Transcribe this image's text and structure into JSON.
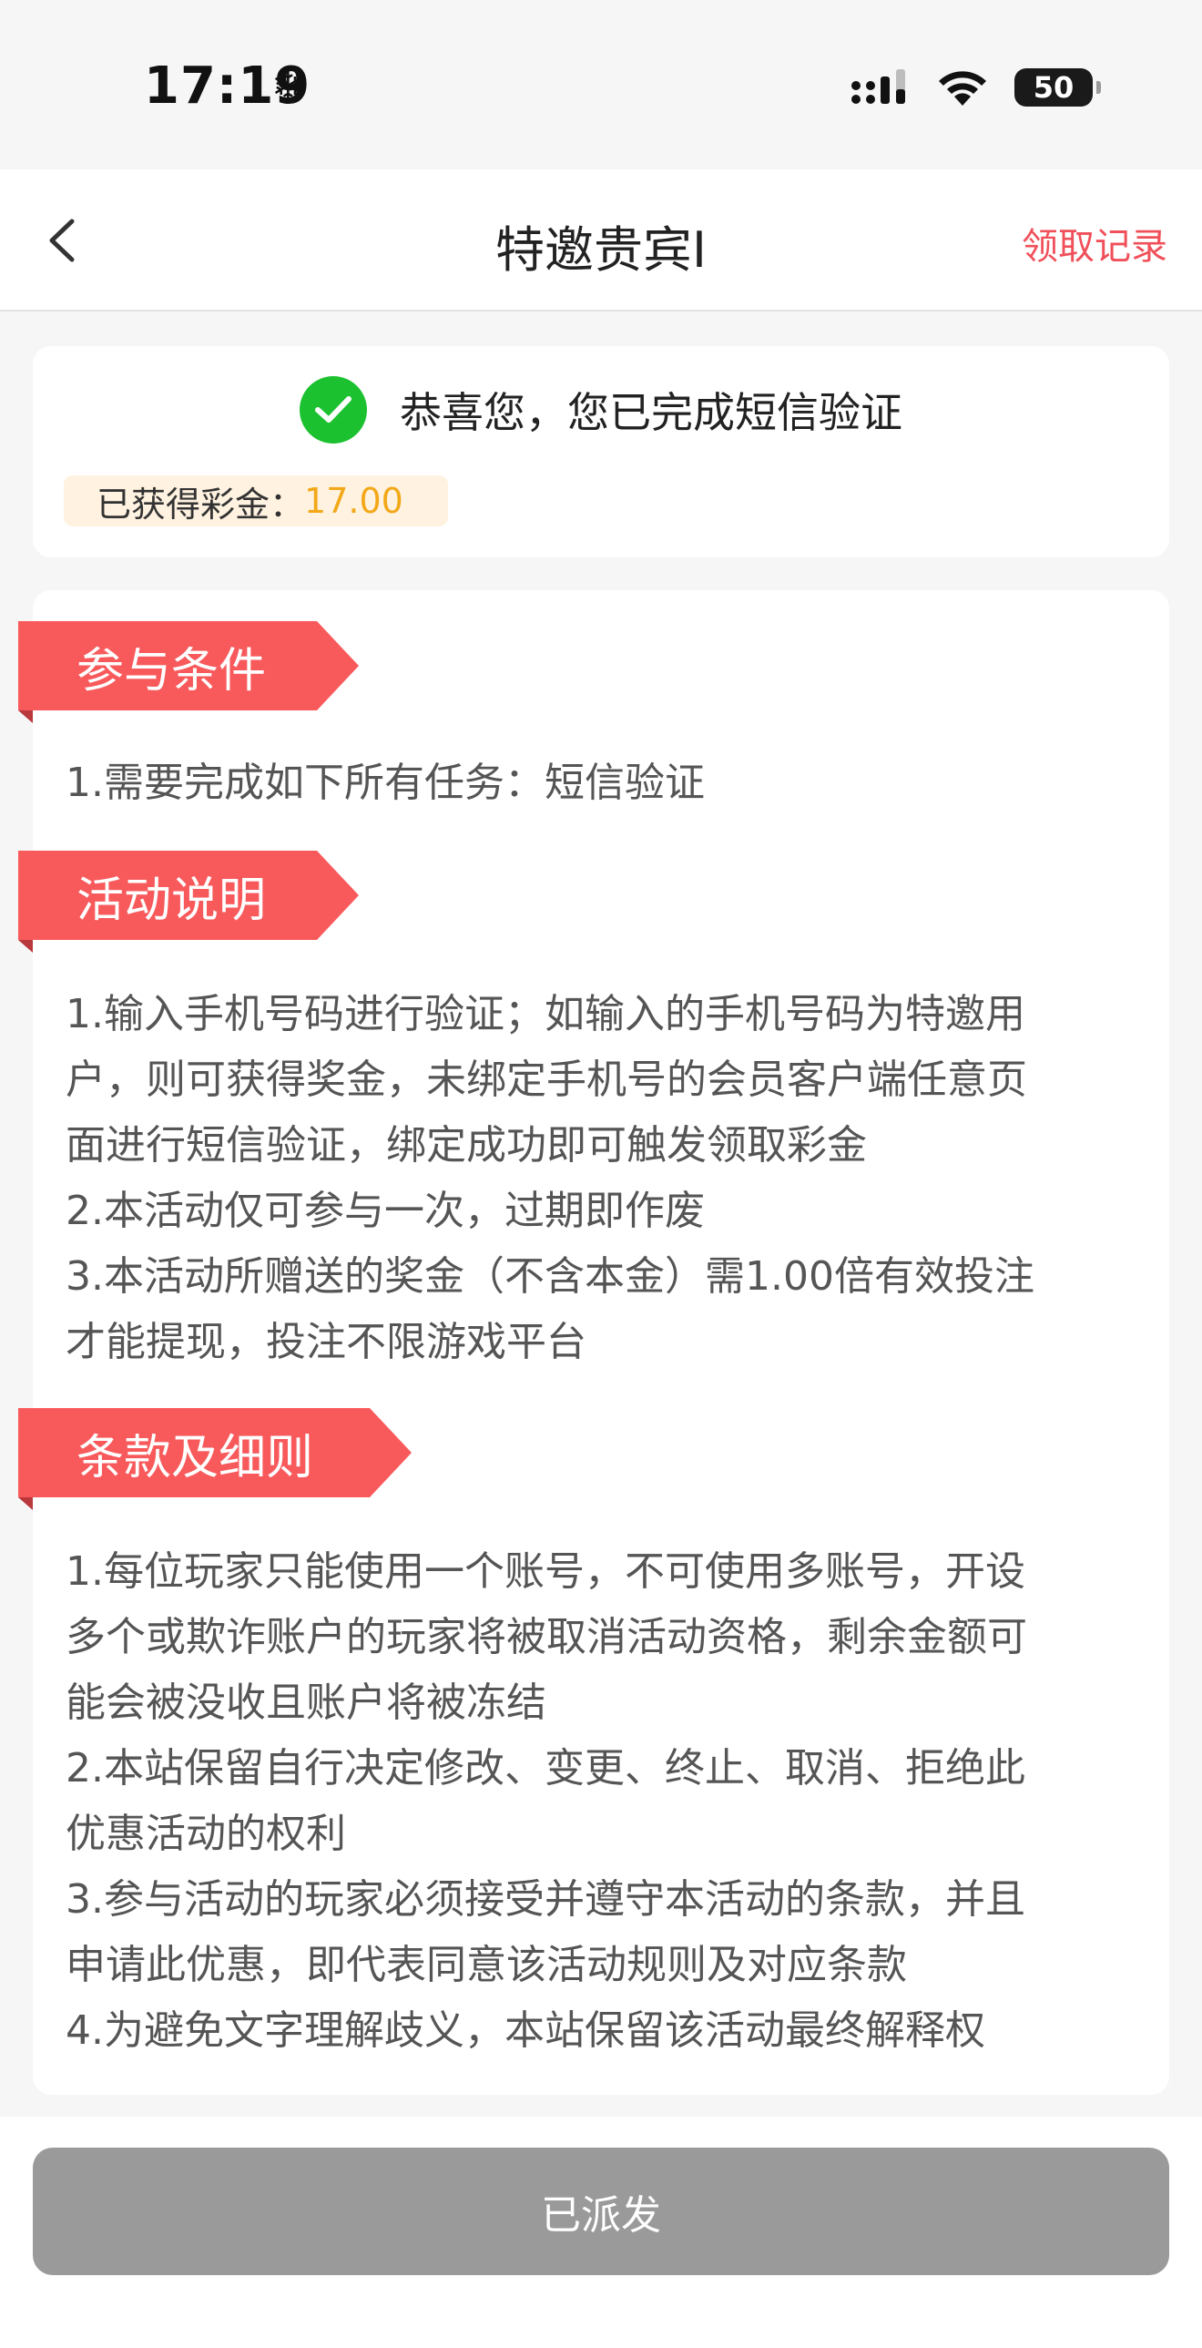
{
  "status_bar": {
    "time": "17:19",
    "battery": "50"
  },
  "nav": {
    "title": "特邀贵宾I",
    "record_link": "领取记录"
  },
  "verify": {
    "message": "恭喜您，您已完成短信验证",
    "bonus_label": "已获得彩金：",
    "bonus_value": "17.00"
  },
  "sections": [
    {
      "title": "参与条件",
      "lines": [
        "1.需要完成如下所有任务：短信验证"
      ]
    },
    {
      "title": "活动说明",
      "lines": [
        "1.输入手机号码进行验证；如输入的手机号码为特邀用",
        "户，则可获得奖金，未绑定手机号的会员客户端任意页",
        "面进行短信验证，绑定成功即可触发领取彩金",
        "2.本活动仅可参与一次，过期即作废",
        "3.本活动所赠送的奖金（不含本金）需1.00倍有效投注",
        "才能提现，投注不限游戏平台"
      ]
    },
    {
      "title": "条款及细则",
      "lines": [
        "1.每位玩家只能使用一个账号，不可使用多账号，开设",
        "多个或欺诈账户的玩家将被取消活动资格，剩余金额可",
        "能会被没收且账户将被冻结",
        "2.本站保留自行决定修改、变更、终止、取消、拒绝此",
        "优惠活动的权利",
        "3.参与活动的玩家必须接受并遵守本活动的条款，并且",
        "申请此优惠，即代表同意该活动规则及对应条款",
        "4.为避免文字理解歧义，本站保留该活动最终解释权"
      ]
    }
  ],
  "button": {
    "label": "已派发"
  },
  "colors": {
    "accent_red": "#f85a5c",
    "link_red": "#f0505a",
    "success_green": "#1cc130",
    "bonus_gold": "#f2a818",
    "button_gray": "#9a9a9a"
  }
}
